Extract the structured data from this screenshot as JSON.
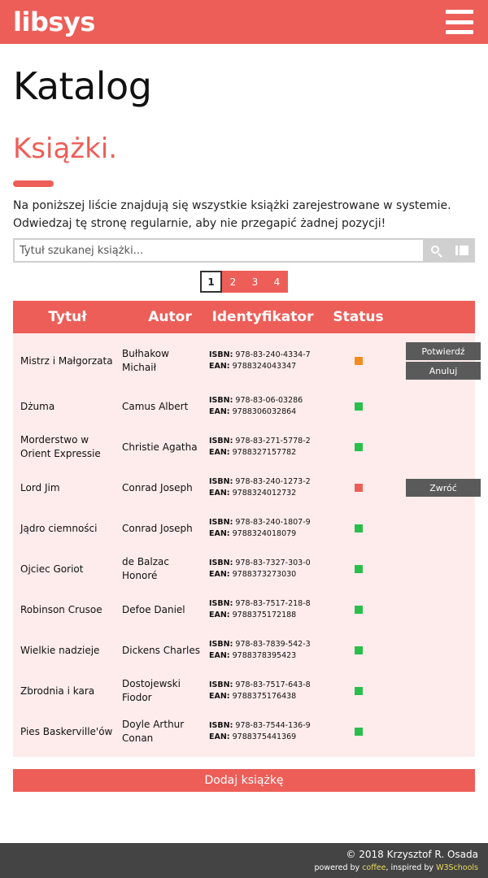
{
  "header": {
    "logo": "libsys",
    "menu_icon": "hamburger-menu-icon"
  },
  "page_title": "Katalog",
  "section_title": "Książki.",
  "intro": "Na poniższej liście znajdują się wszystkie książki zarejestrowane w systemie. Odwiedzaj tę stronę regularnie, aby nie przegapić żadnej pozycji!",
  "search": {
    "placeholder": "Tytuł szukanej książki...",
    "value": "",
    "search_icon": "search-icon",
    "card_icon": "library-card-icon"
  },
  "pagination": {
    "pages": [
      "1",
      "2",
      "3",
      "4"
    ],
    "current": "1"
  },
  "table": {
    "headers": {
      "title": "Tytuł",
      "author": "Autor",
      "id": "Identyfikator",
      "status": "Status"
    },
    "rows": [
      {
        "title": "Mistrz i Małgorzata",
        "author": "Bułhakow Michaił",
        "isbn": "978-83-240-4334-7",
        "ean": "9788324043347",
        "status": "pending",
        "actions": [
          "Potwierdź",
          "Anuluj"
        ]
      },
      {
        "title": "Dżuma",
        "author": "Camus Albert",
        "isbn": "978-83-06-03286",
        "ean": "9788306032864",
        "status": "available",
        "actions": []
      },
      {
        "title": "Morderstwo w Orient Expressie",
        "author": "Christie Agatha",
        "isbn": "978-83-271-5778-2",
        "ean": "9788327157782",
        "status": "available",
        "actions": []
      },
      {
        "title": "Lord Jim",
        "author": "Conrad Joseph",
        "isbn": "978-83-240-1273-2",
        "ean": "9788324012732",
        "status": "borrowed",
        "actions": [
          "Zwróć"
        ]
      },
      {
        "title": "Jądro ciemności",
        "author": "Conrad Joseph",
        "isbn": "978-83-240-1807-9",
        "ean": "9788324018079",
        "status": "available",
        "actions": []
      },
      {
        "title": "Ojciec Goriot",
        "author": "de Balzac Honoré",
        "isbn": "978-83-7327-303-0",
        "ean": "9788373273030",
        "status": "available",
        "actions": []
      },
      {
        "title": "Robinson Crusoe",
        "author": "Defoe Daniel",
        "isbn": "978-83-7517-218-8",
        "ean": "9788375172188",
        "status": "available",
        "actions": []
      },
      {
        "title": "Wielkie nadzieje",
        "author": "Dickens Charles",
        "isbn": "978-83-7839-542-3",
        "ean": "9788378395423",
        "status": "available",
        "actions": []
      },
      {
        "title": "Zbrodnia i kara",
        "author": "Dostojewski Fiodor",
        "isbn": "978-83-7517-643-8",
        "ean": "9788375176438",
        "status": "available",
        "actions": []
      },
      {
        "title": "Pies Baskerville'ów",
        "author": "Doyle Arthur Conan",
        "isbn": "978-83-7544-136-9",
        "ean": "9788375441369",
        "status": "available",
        "actions": []
      }
    ]
  },
  "labels": {
    "isbn": "ISBN:",
    "ean": "EAN:"
  },
  "status_colors": {
    "pending": "#f68b1f",
    "available": "#2abf4a",
    "borrowed": "#ed5e58"
  },
  "add_button": "Dodaj książkę",
  "footer": {
    "copyright": "© 2018 Krzysztof R. Osada",
    "powered_prefix": "powered by ",
    "powered_link": "coffee",
    "inspired_prefix": ", inspired by ",
    "inspired_link": "W3Schools"
  },
  "colors": {
    "accent": "#ed5e58",
    "footer_bg": "#444444",
    "action_button": "#5a5a5a",
    "row_bg": "#fdeceb",
    "footer_link": "#eadb5a"
  }
}
